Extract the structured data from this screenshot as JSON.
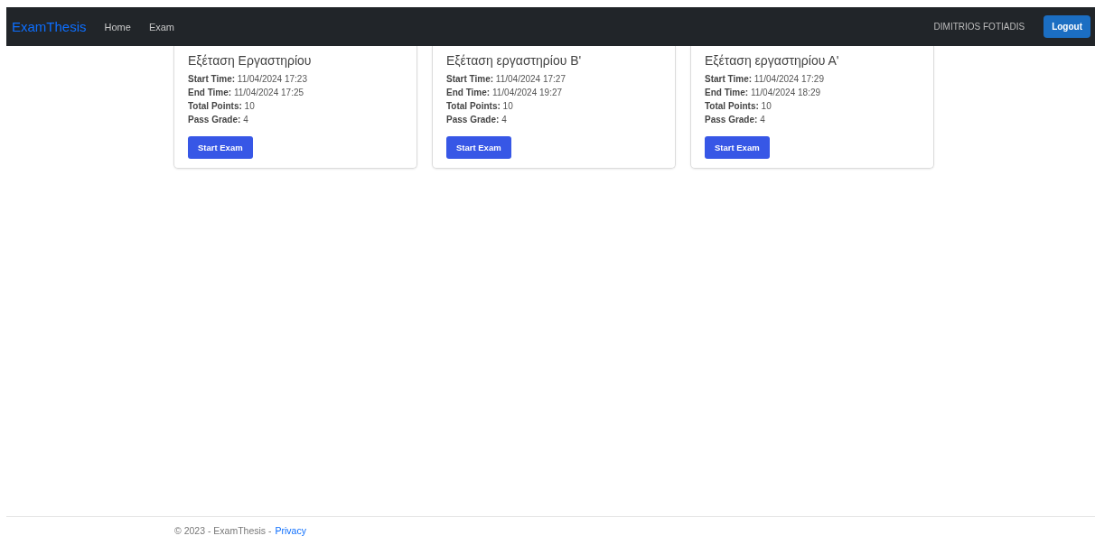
{
  "navbar": {
    "brand": "ExamThesis",
    "links": [
      {
        "label": "Home"
      },
      {
        "label": "Exam"
      }
    ],
    "user": "DIMITRIOS FOTIADIS",
    "logout": "Logout"
  },
  "exams": [
    {
      "title": "Εξέταση Εργαστηρίου",
      "fields": [
        {
          "label": "Start Time:",
          "value": "11/04/2024 17:23"
        },
        {
          "label": "End Time:",
          "value": "11/04/2024 17:25"
        },
        {
          "label": "Total Points:",
          "value": "10"
        },
        {
          "label": "Pass Grade:",
          "value": "4"
        }
      ],
      "button": "Start Exam"
    },
    {
      "title": "Εξέταση εργαστηρίου Β'",
      "fields": [
        {
          "label": "Start Time:",
          "value": "11/04/2024 17:27"
        },
        {
          "label": "End Time:",
          "value": "11/04/2024 19:27"
        },
        {
          "label": "Total Points:",
          "value": "10"
        },
        {
          "label": "Pass Grade:",
          "value": "4"
        }
      ],
      "button": "Start Exam"
    },
    {
      "title": "Εξέταση εργαστηρίου Α'",
      "fields": [
        {
          "label": "Start Time:",
          "value": "11/04/2024 17:29"
        },
        {
          "label": "End Time:",
          "value": "11/04/2024 18:29"
        },
        {
          "label": "Total Points:",
          "value": "10"
        },
        {
          "label": "Pass Grade:",
          "value": "4"
        }
      ],
      "button": "Start Exam"
    }
  ],
  "footer": {
    "text": "© 2023 - ExamThesis -",
    "link": "Privacy"
  }
}
